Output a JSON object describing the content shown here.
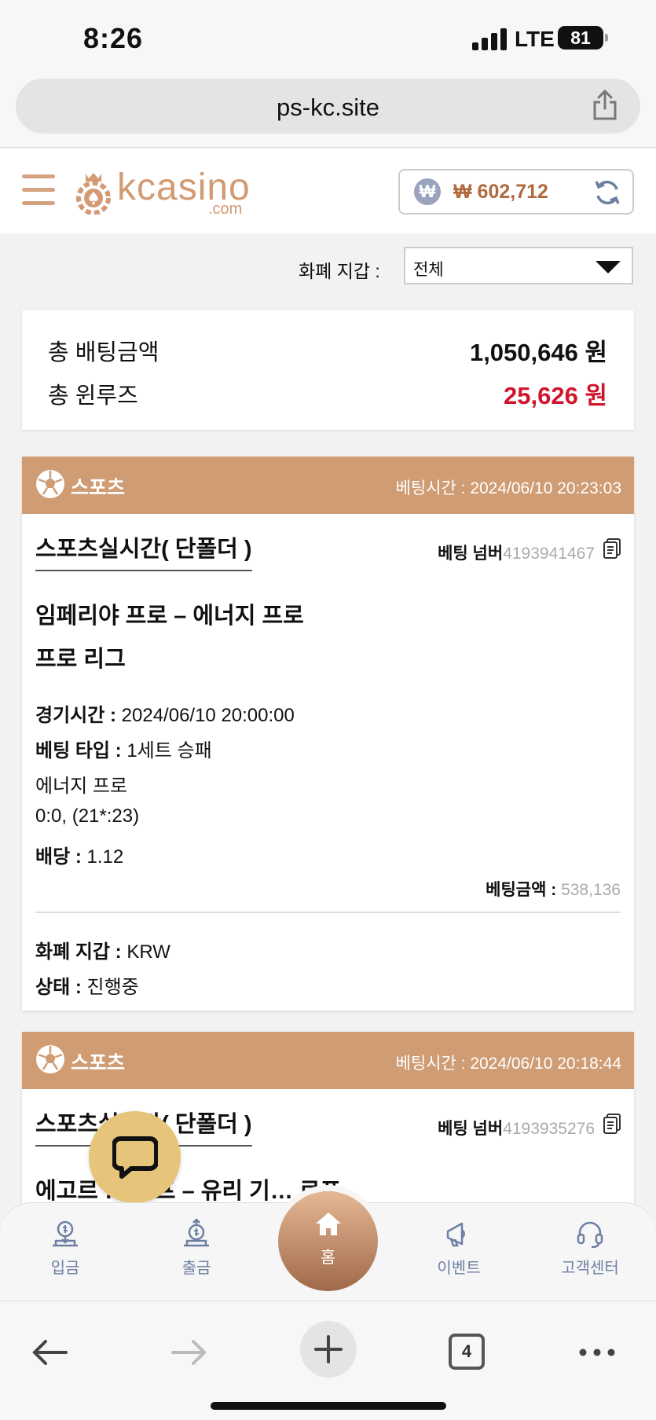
{
  "status_bar": {
    "time": "8:26",
    "network": "LTE",
    "battery": "81"
  },
  "browser": {
    "url": "ps-kc.site",
    "tab_count": "4"
  },
  "header": {
    "logo_text": "kcasino",
    "logo_sub": ".com",
    "balance": "₩ 602,712",
    "currency_symbol": "₩"
  },
  "filter": {
    "label": "화폐 지갑 :",
    "selected": "전체"
  },
  "totals": {
    "bet_label": "총 배팅금액",
    "bet_value": "1,050,646 원",
    "loss_label": "총 윈루즈",
    "loss_value": "25,626 원"
  },
  "bets": [
    {
      "category": "스포츠",
      "bet_time": "베팅시간 : 2024/06/10 20:23:03",
      "title": "스포츠실시간( 단폴더 )",
      "bet_no_label": "베팅 넘버",
      "bet_no": "4193941467",
      "match_line1": "임페리야 프로 – 에너지 프로",
      "match_line2": "프로 리그",
      "game_time_label": "경기시간 :",
      "game_time": "2024/06/10 20:00:00",
      "bet_type_label": "베팅 타입 :",
      "bet_type": "1세트 승패",
      "pick": "에너지 프로",
      "score": "0:0, (21*:23)",
      "odds_label": "배당 :",
      "odds": "1.12",
      "stake_label": "베팅금액 :",
      "stake": "538,136",
      "wallet_label": "화폐 지갑 :",
      "wallet": "KRW",
      "status_label": "상태 :",
      "status": "진행중"
    },
    {
      "category": "스포츠",
      "bet_time": "베팅시간 : 2024/06/10 20:18:44",
      "title": "스포츠실시간( 단폴더 )",
      "bet_no_label": "베팅 넘버",
      "bet_no": "4193935276",
      "match_line1": "에고르 … 노프 – 유리 기… 로프"
    }
  ],
  "bottom_nav": [
    {
      "label": "입금",
      "icon": "deposit-icon"
    },
    {
      "label": "출금",
      "icon": "withdraw-icon"
    },
    {
      "label": "홈",
      "icon": "home-icon"
    },
    {
      "label": "이벤트",
      "icon": "megaphone-icon"
    },
    {
      "label": "고객센터",
      "icon": "headset-icon"
    }
  ],
  "colors": {
    "accent": "#cf9c74",
    "loss": "#d0162e",
    "nav": "#6d7fa3",
    "chat": "#e6c57b"
  }
}
